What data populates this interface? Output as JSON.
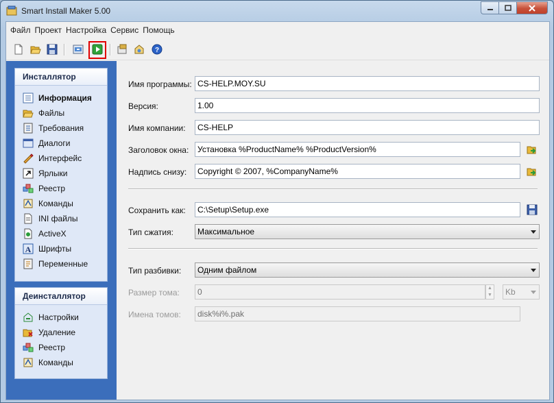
{
  "window": {
    "title": "Smart Install Maker 5.00"
  },
  "menu": [
    "Файл",
    "Проект",
    "Настройка",
    "Сервис",
    "Помощь"
  ],
  "toolbar": {
    "icons": [
      "new-file-icon",
      "open-folder-icon",
      "save-disk-icon",
      "build-icon",
      "run-play-icon",
      "settings-icon",
      "update-icon",
      "help-icon"
    ]
  },
  "sidebar": {
    "installer_title": "Инсталлятор",
    "installer_items": [
      {
        "label": "Информация",
        "icon": "info-list-icon",
        "active": true
      },
      {
        "label": "Файлы",
        "icon": "folder-open-icon"
      },
      {
        "label": "Требования",
        "icon": "requirements-icon"
      },
      {
        "label": "Диалоги",
        "icon": "dialogs-icon"
      },
      {
        "label": "Интерфейс",
        "icon": "interface-icon"
      },
      {
        "label": "Ярлыки",
        "icon": "shortcut-icon"
      },
      {
        "label": "Реестр",
        "icon": "registry-icon"
      },
      {
        "label": "Команды",
        "icon": "commands-icon"
      },
      {
        "label": "INI файлы",
        "icon": "ini-file-icon"
      },
      {
        "label": "ActiveX",
        "icon": "activex-icon"
      },
      {
        "label": "Шрифты",
        "icon": "fonts-icon"
      },
      {
        "label": "Переменные",
        "icon": "variables-icon"
      }
    ],
    "uninstaller_title": "Деинсталлятор",
    "uninstaller_items": [
      {
        "label": "Настройки",
        "icon": "uninstall-settings-icon"
      },
      {
        "label": "Удаление",
        "icon": "delete-folder-icon"
      },
      {
        "label": "Реестр",
        "icon": "registry-icon"
      },
      {
        "label": "Команды",
        "icon": "commands-icon"
      }
    ]
  },
  "form": {
    "program_name": {
      "label": "Имя программы:",
      "value": "CS-HELP.MOY.SU"
    },
    "version": {
      "label": "Версия:",
      "value": "1.00"
    },
    "company": {
      "label": "Имя компании:",
      "value": "CS-HELP"
    },
    "window_title": {
      "label": "Заголовок окна:",
      "value": "Установка %ProductName% %ProductVersion%"
    },
    "footer_text": {
      "label": "Надпись снизу:",
      "value": "Copyright © 2007, %CompanyName%"
    },
    "save_as": {
      "label": "Сохранить как:",
      "value": "C:\\Setup\\Setup.exe"
    },
    "compression": {
      "label": "Тип сжатия:",
      "value": "Максимальное"
    },
    "split_type": {
      "label": "Тип разбивки:",
      "value": "Одним файлом"
    },
    "volume_size": {
      "label": "Размер тома:",
      "value": "0",
      "unit": "Kb"
    },
    "volume_names": {
      "label": "Имена томов:",
      "value": "disk%i%.pak"
    }
  }
}
